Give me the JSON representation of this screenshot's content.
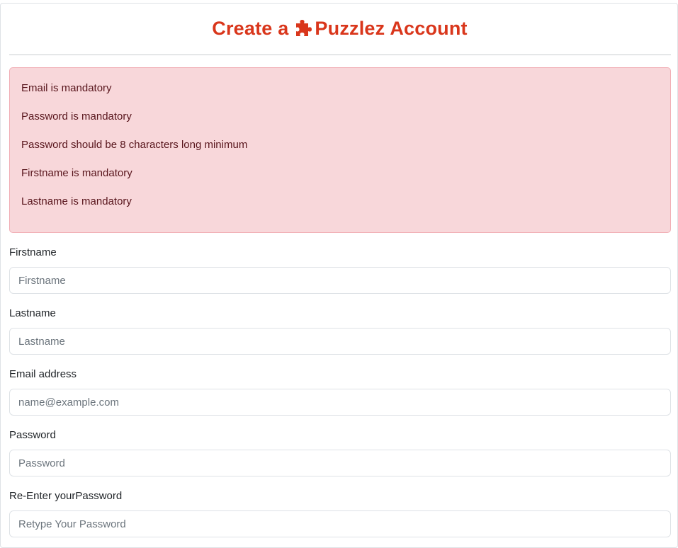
{
  "header": {
    "title_prefix": "Create a",
    "brand": "Puzzlez",
    "title_suffix": "Account",
    "accent_color": "#d9361b"
  },
  "errors": [
    "Email is mandatory",
    "Password is mandatory",
    "Password should be 8 characters long minimum",
    "Firstname is mandatory",
    "Lastname is mandatory"
  ],
  "form": {
    "firstname": {
      "label": "Firstname",
      "placeholder": "Firstname",
      "value": ""
    },
    "lastname": {
      "label": "Lastname",
      "placeholder": "Lastname",
      "value": ""
    },
    "email": {
      "label": "Email address",
      "placeholder": "name@example.com",
      "value": ""
    },
    "password": {
      "label": "Password",
      "placeholder": "Password",
      "value": ""
    },
    "confirm_password": {
      "label": "Re-Enter yourPassword",
      "placeholder": "Retype Your Password",
      "value": ""
    }
  },
  "icons": {
    "brand_icon": "puzzle-piece-icon"
  }
}
